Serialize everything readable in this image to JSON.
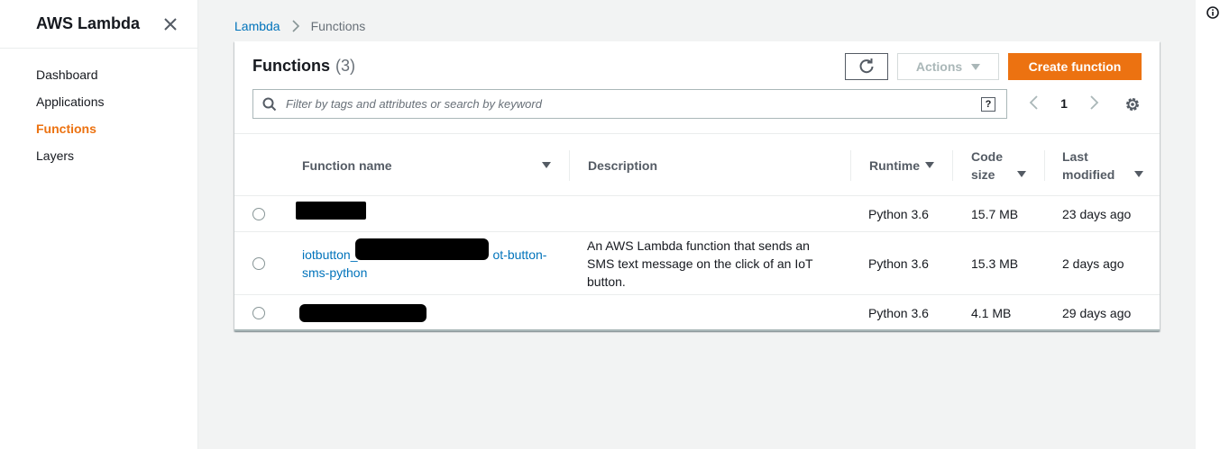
{
  "sidebar": {
    "title": "AWS Lambda",
    "items": [
      {
        "label": "Dashboard"
      },
      {
        "label": "Applications"
      },
      {
        "label": "Functions"
      },
      {
        "label": "Layers"
      }
    ]
  },
  "breadcrumb": {
    "root": "Lambda",
    "current": "Functions"
  },
  "panel": {
    "title": "Functions",
    "count": "(3)",
    "actions_label": "Actions",
    "create_label": "Create function",
    "search_placeholder": "Filter by tags and attributes or search by keyword",
    "page": "1"
  },
  "table": {
    "headers": {
      "name": "Function name",
      "description": "Description",
      "runtime": "Runtime",
      "code_size_1": "Code",
      "code_size_2": "size",
      "last_modified_1": "Last",
      "last_modified_2": "modified"
    },
    "rows": [
      {
        "name": "",
        "description": "",
        "runtime": "Python 3.6",
        "code_size": "15.7 MB",
        "last_modified": "23 days ago"
      },
      {
        "name_1": "iotbutton_",
        "name_1b": "ot-button-",
        "name_2": "sms-python",
        "description_1": "An AWS Lambda function that sends an",
        "description_2": "SMS text message on the click of an IoT",
        "description_3": "button.",
        "runtime": "Python 3.6",
        "code_size": "15.3 MB",
        "last_modified": "2 days ago"
      },
      {
        "name": "",
        "description": "",
        "runtime": "Python 3.6",
        "code_size": "4.1 MB",
        "last_modified": "29 days ago"
      }
    ]
  },
  "colors": {
    "accent": "#ec7211",
    "link": "#0073bb"
  }
}
